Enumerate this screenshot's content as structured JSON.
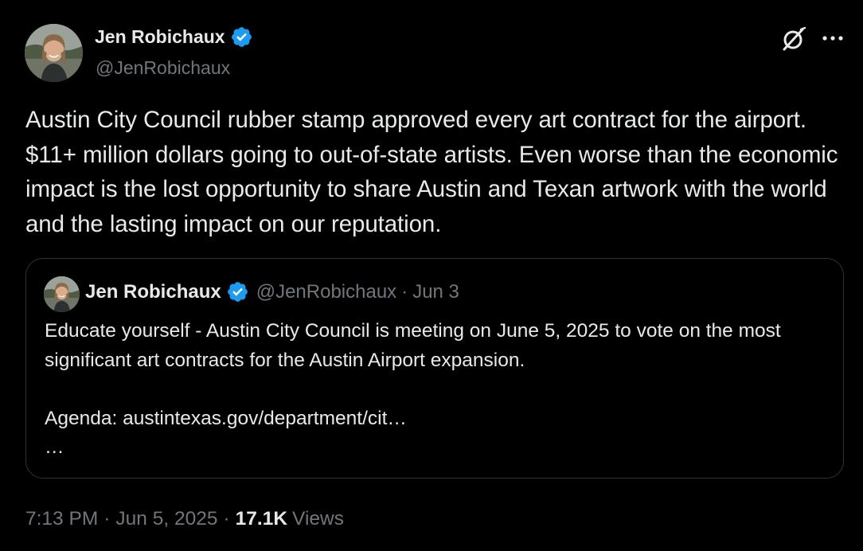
{
  "author": {
    "name": "Jen Robichaux",
    "handle": "@JenRobichaux",
    "verified": true
  },
  "tweet": {
    "text": "Austin City Council rubber stamp approved every art contract for the airport. $11+ million dollars going to out-of-state artists. Even worse than the economic impact is the lost opportunity to share Austin and Texan artwork with the world and the lasting impact on our reputation."
  },
  "quoted": {
    "name": "Jen Robichaux",
    "handle": "@JenRobichaux",
    "separator": "·",
    "date": "Jun 3",
    "text": "Educate yourself - Austin City Council is meeting on June 5, 2025 to vote on the most significant art contracts for the Austin Airport expansion.\n\nAgenda: austintexas.gov/department/cit…\n…"
  },
  "meta": {
    "time": "7:13 PM",
    "separator": "·",
    "date": "Jun 5, 2025",
    "views_count": "17.1K",
    "views_label": "Views"
  },
  "icons": {
    "header_left": "grok-icon",
    "header_right": "more-icon",
    "badge": "verified-badge-icon"
  },
  "colors": {
    "background": "#000000",
    "text_primary": "#e7e9ea",
    "text_secondary": "#71767b",
    "verified_blue": "#1d9bf0",
    "border": "#2f3336"
  }
}
